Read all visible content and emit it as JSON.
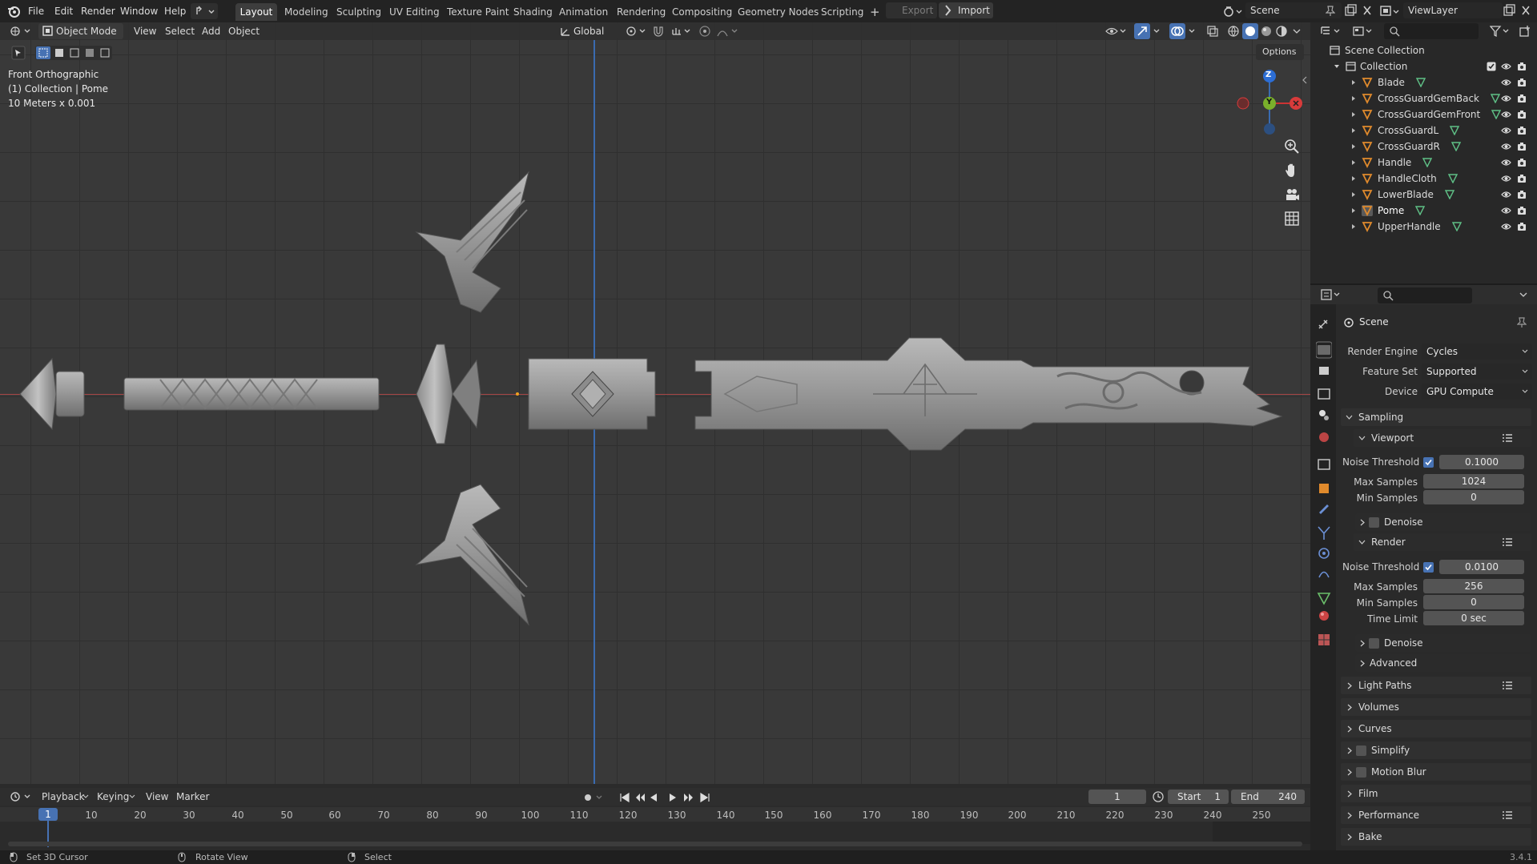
{
  "topbar": {
    "menus": [
      "File",
      "Edit",
      "Render",
      "Window",
      "Help"
    ],
    "workspaces": [
      "Layout",
      "Modeling",
      "Sculpting",
      "UV Editing",
      "Texture Paint",
      "Shading",
      "Animation",
      "Rendering",
      "Compositing",
      "Geometry Nodes",
      "Scripting"
    ],
    "active_workspace": "Layout",
    "export_label": "Export",
    "import_label": "Import",
    "scene_name": "Scene",
    "view_layer": "ViewLayer"
  },
  "viewport": {
    "mode": "Object Mode",
    "menus": [
      "View",
      "Select",
      "Add",
      "Object"
    ],
    "orientation": "Global",
    "options_label": "Options",
    "overlay_lines": [
      "Front Orthographic",
      "(1) Collection | Pome",
      "10 Meters x 0.001"
    ],
    "gizmo_axes": {
      "z": "Z",
      "y": "Y"
    },
    "background_color": "#393939",
    "x_axis_color": "#a84747",
    "z_axis_color": "#3a6bb0"
  },
  "outliner": {
    "root": "Scene Collection",
    "collection": "Collection",
    "objects": [
      "Blade",
      "CrossGuardGemBack",
      "CrossGuardGemFront",
      "CrossGuardL",
      "CrossGuardR",
      "Handle",
      "HandleCloth",
      "LowerBlade",
      "Pome",
      "UpperHandle"
    ],
    "active_object": "Pome"
  },
  "properties": {
    "context": "Scene",
    "render_engine_label": "Render Engine",
    "render_engine": "Cycles",
    "feature_set_label": "Feature Set",
    "feature_set": "Supported",
    "device_label": "Device",
    "device": "GPU Compute",
    "sampling_label": "Sampling",
    "viewport_label": "Viewport",
    "render_label": "Render",
    "noise_threshold_label": "Noise Threshold",
    "max_samples_label": "Max Samples",
    "min_samples_label": "Min Samples",
    "time_limit_label": "Time Limit",
    "denoise_label": "Denoise",
    "advanced_label": "Advanced",
    "viewport_noise_threshold": "0.1000",
    "viewport_max_samples": "1024",
    "viewport_min_samples": "0",
    "render_noise_threshold": "0.0100",
    "render_max_samples": "256",
    "render_min_samples": "0",
    "render_time_limit": "0 sec",
    "sections": [
      "Light Paths",
      "Volumes",
      "Curves",
      "Simplify",
      "Motion Blur",
      "Film",
      "Performance",
      "Bake"
    ]
  },
  "timeline": {
    "menus": [
      "Playback",
      "Keying",
      "View",
      "Marker"
    ],
    "current_frame": "1",
    "start_label": "Start",
    "start": "1",
    "end_label": "End",
    "end": "240",
    "ruler": [
      "10",
      "20",
      "30",
      "40",
      "50",
      "60",
      "70",
      "80",
      "90",
      "100",
      "110",
      "120",
      "130",
      "140",
      "150",
      "160",
      "170",
      "180",
      "190",
      "200",
      "210",
      "220",
      "230",
      "240",
      "250"
    ]
  },
  "status": {
    "left": "Set 3D Cursor",
    "middle": "Rotate View",
    "right": "Select",
    "version": "3.4.1"
  }
}
